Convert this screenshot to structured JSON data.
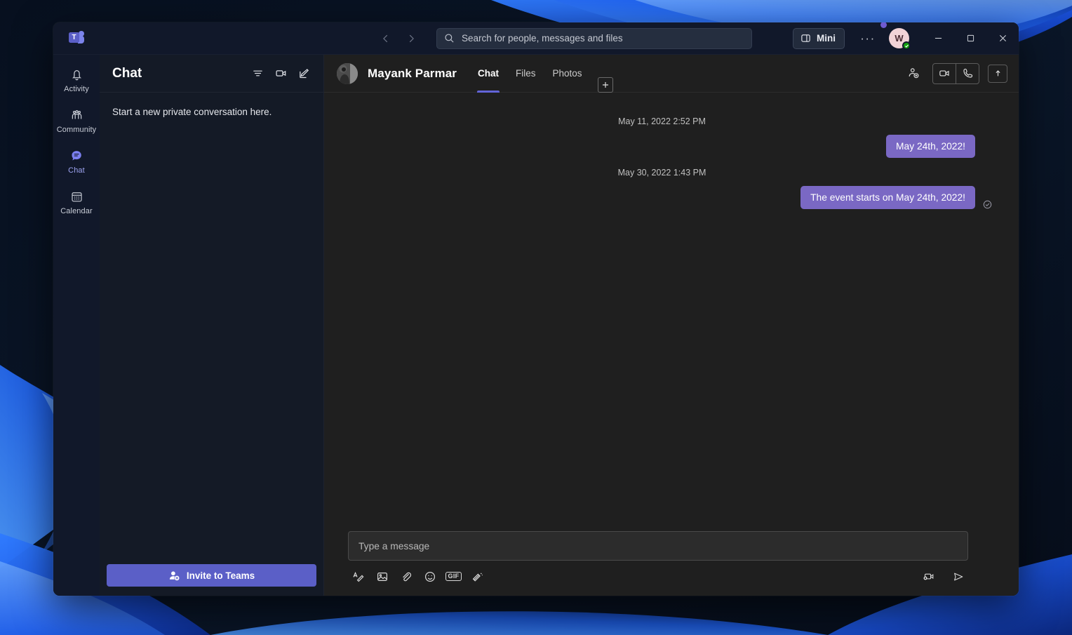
{
  "window": {
    "app_logo_letter": "T"
  },
  "titlebar": {
    "back_icon": "chevron-left-icon",
    "forward_icon": "chevron-right-icon",
    "search": {
      "placeholder": "Search for people, messages and files",
      "value": "",
      "icon": "search-icon"
    },
    "mini_label": "Mini",
    "mini_icon": "mini-window-icon",
    "more_label": "···",
    "avatar_initial": "W",
    "avatar_bg": "#f2d3d7",
    "status_color": "#13a10e",
    "notification_dot_color": "#6f5bd0",
    "minimize_icon": "minimize-icon",
    "maximize_icon": "maximize-icon",
    "close_icon": "close-icon"
  },
  "rail": {
    "items": [
      {
        "label": "Activity",
        "icon": "bell-icon",
        "active": false
      },
      {
        "label": "Community",
        "icon": "people-community-icon",
        "active": false
      },
      {
        "label": "Chat",
        "icon": "chat-bubble-icon",
        "active": true
      },
      {
        "label": "Calendar",
        "icon": "calendar-icon",
        "active": false
      }
    ],
    "accent_color": "#6264d8"
  },
  "chat_list": {
    "title": "Chat",
    "actions": [
      {
        "name": "filter-icon",
        "label": "Filter"
      },
      {
        "name": "video-call-icon",
        "label": "Meet now"
      },
      {
        "name": "compose-icon",
        "label": "New chat"
      }
    ],
    "empty_text": "Start a new private conversation here.",
    "invite_label": "Invite to Teams",
    "invite_icon": "add-person-icon",
    "invite_color": "#5b5fc7"
  },
  "conversation": {
    "contact_name": "Mayank Parmar",
    "tabs": [
      {
        "label": "Chat",
        "active": true
      },
      {
        "label": "Files",
        "active": false
      },
      {
        "label": "Photos",
        "active": false
      }
    ],
    "add_tab_icon": "plus-icon",
    "header_actions": [
      {
        "name": "add-people-icon",
        "label": "Add people"
      },
      {
        "name": "video-call-icon",
        "label": "Video call"
      },
      {
        "name": "audio-call-icon",
        "label": "Audio call"
      },
      {
        "name": "pop-out-icon",
        "label": "Open in new window"
      }
    ],
    "bubble_color": "#7a68c4",
    "messages": [
      {
        "timestamp": "May 11, 2022 2:52 PM",
        "text": "May 24th, 2022!",
        "outgoing": true,
        "read_receipt": false
      },
      {
        "timestamp": "May 30, 2022 1:43 PM",
        "text": "The event starts on May 24th, 2022!",
        "outgoing": true,
        "read_receipt": true
      }
    ]
  },
  "compose": {
    "placeholder": "Type a message",
    "value": "",
    "tools": [
      {
        "name": "format-text-icon",
        "label": "Format"
      },
      {
        "name": "image-icon",
        "label": "Image"
      },
      {
        "name": "attach-icon",
        "label": "Attach"
      },
      {
        "name": "emoji-icon",
        "label": "Emoji"
      },
      {
        "name": "gif-icon",
        "label": "GIF"
      },
      {
        "name": "sticker-icon",
        "label": "Sticker"
      }
    ],
    "gif_label": "GIF",
    "right_tools": [
      {
        "name": "video-message-icon",
        "label": "Video message"
      },
      {
        "name": "send-icon",
        "label": "Send"
      }
    ]
  }
}
